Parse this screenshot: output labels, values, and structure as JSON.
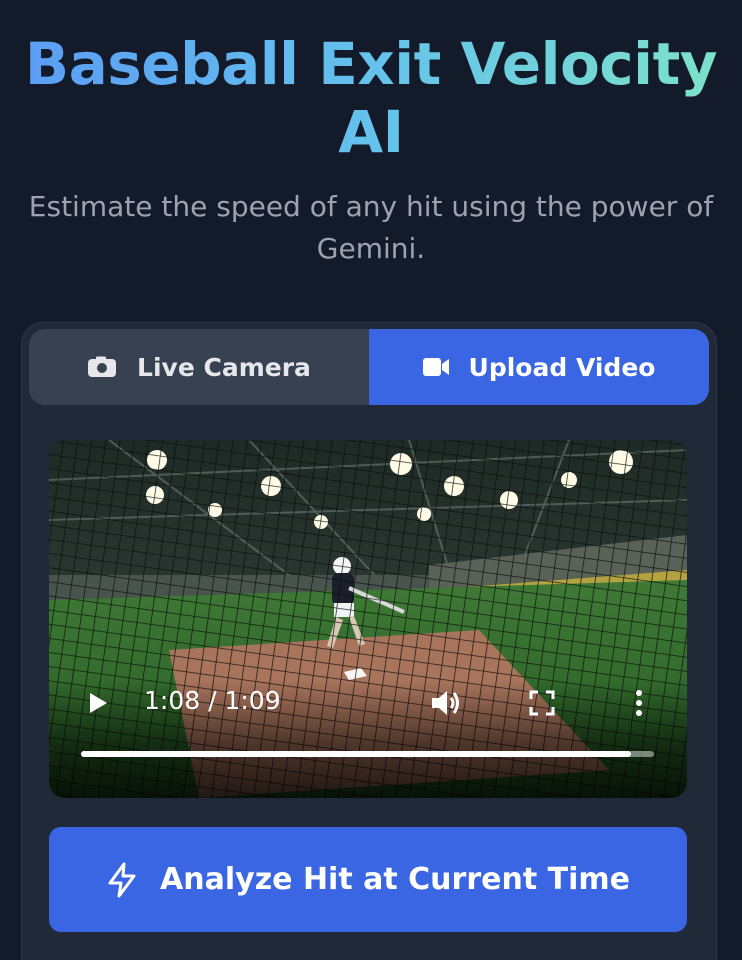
{
  "header": {
    "title": "Baseball Exit Velocity AI",
    "subtitle": "Estimate the speed of any hit using the power of Gemini."
  },
  "tabs": [
    {
      "label": "Live Camera",
      "icon": "camera-icon",
      "active": false
    },
    {
      "label": "Upload Video",
      "icon": "video-camera-icon",
      "active": true
    }
  ],
  "video": {
    "current_time": "1:08",
    "duration": "1:09",
    "time_display": "1:08 / 1:09",
    "progress_fraction": 0.96,
    "controls": [
      "play-icon",
      "volume-icon",
      "fullscreen-icon",
      "more-options-icon"
    ]
  },
  "analyze_button": {
    "label": "Analyze Hit at Current Time",
    "icon": "lightning-bolt-icon"
  },
  "colors": {
    "background": "#131a29",
    "card": "#1f2937",
    "accent": "#3b66e3",
    "tab_inactive": "#374151",
    "title_gradient": [
      "#5b9df5",
      "#7ce2c8"
    ],
    "muted_text": "#9ca3af"
  }
}
